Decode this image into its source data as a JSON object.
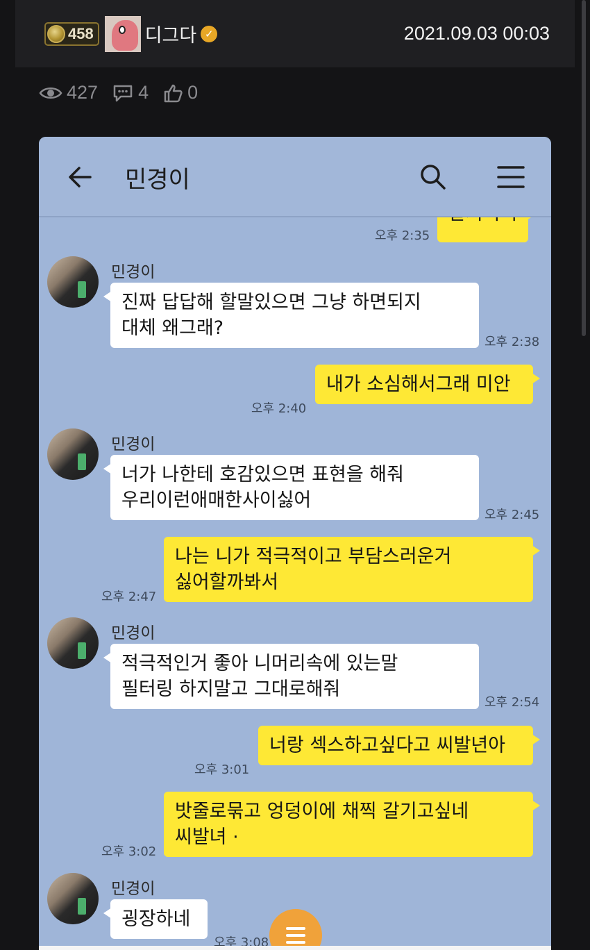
{
  "post": {
    "level": "458",
    "nickname": "디그다",
    "verified_mark": "✓",
    "date": "2021.09.03 00:03",
    "views": "427",
    "comments": "4",
    "likes": "0"
  },
  "icons": {
    "eye": "eye-icon",
    "comment": "comment-icon",
    "like": "thumbs-up-icon",
    "back": "back-arrow-icon",
    "search": "search-icon",
    "menu": "menu-icon"
  },
  "chat": {
    "room_title": "민경이",
    "colors": {
      "background": "#9fb5d8",
      "mine": "#fee835",
      "theirs": "#ffffff"
    },
    "messages": [
      {
        "from": "me",
        "text": "갈거이니",
        "time": "오후 2:35"
      },
      {
        "from": "민경이",
        "text": "진짜 답답해 할말있으면 그냥 하면되지\n대체 왜그래?",
        "time": "오후 2:38"
      },
      {
        "from": "me",
        "text": "내가 소심해서그래 미안",
        "time": "오후 2:40"
      },
      {
        "from": "민경이",
        "text": "너가 나한테 호감있으면 표현을 해줘\n우리이런애매한사이싫어",
        "time": "오후 2:45"
      },
      {
        "from": "me",
        "text": "나는 니가 적극적이고 부담스러운거\n싫어할까봐서",
        "time": "오후 2:47"
      },
      {
        "from": "민경이",
        "text": "적극적인거 좋아 니머리속에 있는말\n필터링 하지말고 그대로해줘",
        "time": "오후 2:54"
      },
      {
        "from": "me",
        "text": "너랑 섹스하고싶다고 씨발년아",
        "time": "오후 3:01"
      },
      {
        "from": "me",
        "text": "밧줄로묶고 엉덩이에 채찍 갈기고싶네\n씨발녀 ·",
        "time": "오후 3:02"
      },
      {
        "from": "민경이",
        "text": "굉장하네",
        "time": "오후 3:08"
      }
    ]
  }
}
